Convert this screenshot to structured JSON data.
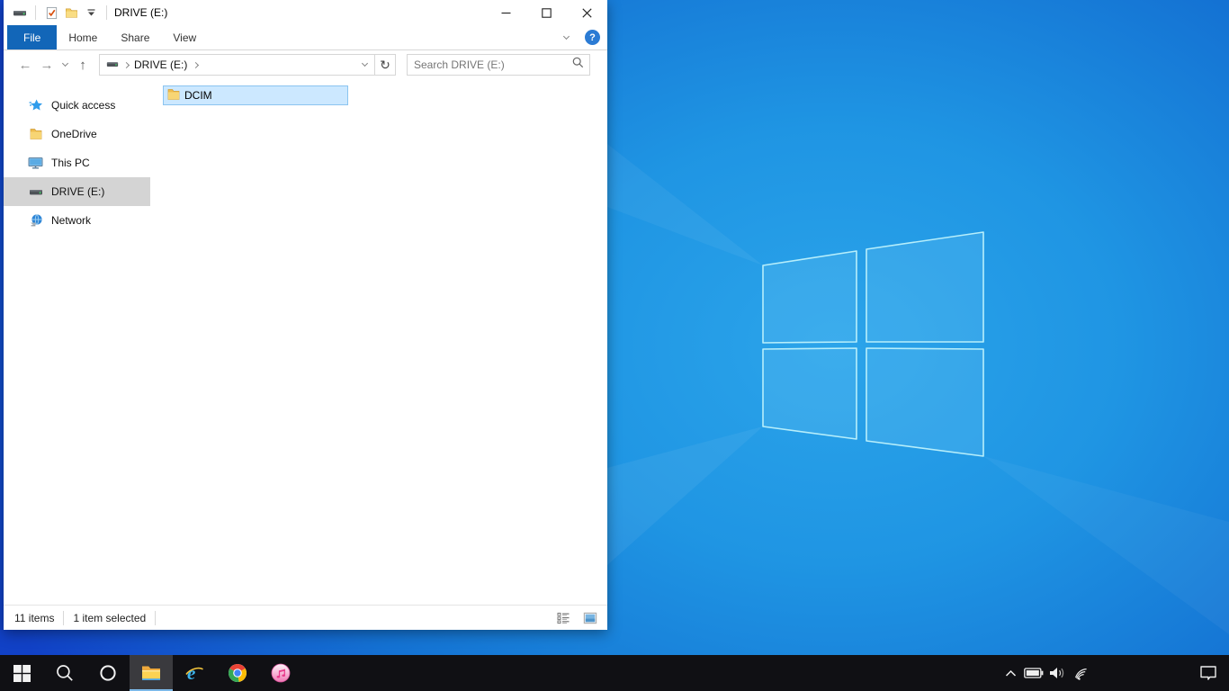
{
  "colors": {
    "accent_blue": "#1266b8",
    "selection_fill": "#cce8ff",
    "selection_border": "#8bc4f0",
    "sidebar_selected": "#d4d4d4",
    "taskbar_bg": "#101014",
    "taskbar_active_underline": "#7cb8e8",
    "wallpaper_bright": "#2ba4ea",
    "wallpaper_deep": "#1141c6",
    "folder_yellow": "#f7cf5f"
  },
  "titlebar": {
    "title": "DRIVE (E:)",
    "window_icon": "drive-icon",
    "qat": {
      "properties_icon": "properties-check-icon",
      "new_folder_icon": "new-folder-icon",
      "customize_icon": "toolbar-chevron-down-icon"
    }
  },
  "ribbon": {
    "tabs": [
      {
        "label": "File",
        "active": true
      },
      {
        "label": "Home",
        "active": false
      },
      {
        "label": "Share",
        "active": false
      },
      {
        "label": "View",
        "active": false
      }
    ],
    "help_label": "?"
  },
  "navbar": {
    "back_glyph": "←",
    "forward_glyph": "→",
    "up_glyph": "↑",
    "refresh_glyph": "↻",
    "address": {
      "crumbs": [
        {
          "label": "DRIVE (E:)"
        }
      ]
    },
    "search_placeholder": "Search DRIVE (E:)"
  },
  "sidebar": {
    "items": [
      {
        "label": "Quick access",
        "icon": "star-icon",
        "selected": false
      },
      {
        "label": "OneDrive",
        "icon": "folder-icon",
        "selected": false
      },
      {
        "label": "This PC",
        "icon": "monitor-icon",
        "selected": false
      },
      {
        "label": "DRIVE (E:)",
        "icon": "drive-icon",
        "selected": true
      },
      {
        "label": "Network",
        "icon": "network-icon",
        "selected": false
      }
    ]
  },
  "content": {
    "files": [
      {
        "name": "DCIM",
        "icon": "folder-icon",
        "selected": true
      }
    ]
  },
  "statusbar": {
    "items_count": "11 items",
    "selection_count": "1 item selected",
    "view_icons": [
      "details-view-icon",
      "large-icons-view-icon"
    ]
  },
  "taskbar": {
    "buttons": [
      {
        "name": "start",
        "icon": "windows-logo-icon"
      },
      {
        "name": "search",
        "icon": "search-icon"
      },
      {
        "name": "cortana",
        "icon": "cortana-circle-icon"
      },
      {
        "name": "file-explorer",
        "icon": "explorer-folder-icon",
        "active": true
      },
      {
        "name": "internet-explorer",
        "icon": "ie-icon"
      },
      {
        "name": "chrome",
        "icon": "chrome-icon"
      },
      {
        "name": "itunes",
        "icon": "itunes-icon"
      }
    ],
    "tray": [
      {
        "name": "hidden-icons",
        "icon": "chevron-up-icon"
      },
      {
        "name": "battery",
        "icon": "battery-icon"
      },
      {
        "name": "volume",
        "icon": "volume-icon"
      },
      {
        "name": "wifi",
        "icon": "wifi-icon"
      }
    ],
    "action_center": {
      "name": "action-center",
      "icon": "notification-bubble-icon"
    }
  },
  "wallpaper": {
    "name": "windows-10-light-wallpaper",
    "logo": "windows-logo"
  }
}
